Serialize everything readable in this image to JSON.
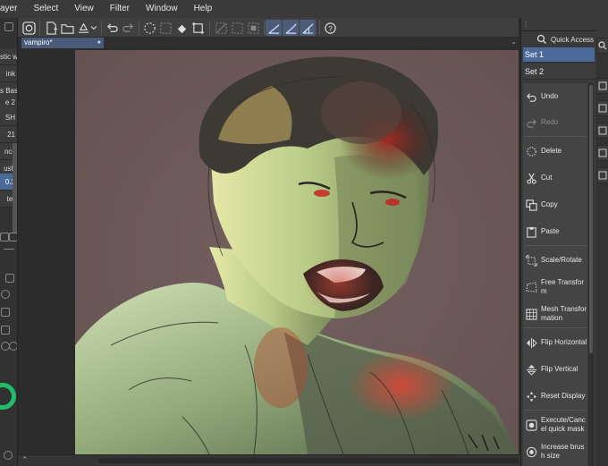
{
  "menubar": {
    "items": [
      "ayer",
      "Select",
      "View",
      "Filter",
      "Window",
      "Help"
    ]
  },
  "toolbar": {
    "icons": [
      "clip-studio-icon",
      "new-file-icon",
      "open-file-icon",
      "save-icon",
      "chevron-down-icon",
      "undo-icon",
      "redo-icon",
      "clear-icon",
      "fill-icon",
      "fill-alt-icon",
      "transform-icon",
      "deselect-icon",
      "invert-icon",
      "show-selection-icon",
      "line-snap-icon",
      "curve-snap-icon",
      "ruler-snap-icon",
      "help-icon"
    ]
  },
  "left_panel": {
    "rows": [
      "stic w",
      "ink",
      "s Basi",
      "e 2",
      "SH",
      "21",
      "ncil",
      "ush",
      "0.3",
      "ter"
    ],
    "selected_index": 8
  },
  "tab": {
    "title": "vampiro*",
    "close": "●"
  },
  "right_panel": {
    "title": "Quick Access",
    "sets": [
      "Set 1",
      "Set 2"
    ],
    "selected_set": 0,
    "commands": [
      {
        "label": "Undo",
        "icon": "undo-icon",
        "enabled": true
      },
      {
        "label": "Redo",
        "icon": "redo-icon",
        "enabled": false
      },
      {
        "label": "Delete",
        "icon": "delete-icon",
        "enabled": true
      },
      {
        "label": "Cut",
        "icon": "scissors-icon",
        "enabled": true
      },
      {
        "label": "Copy",
        "icon": "copy-icon",
        "enabled": true
      },
      {
        "label": "Paste",
        "icon": "paste-icon",
        "enabled": true
      },
      {
        "label": "Scale/Rotate",
        "icon": "scale-rotate-icon",
        "enabled": true
      },
      {
        "label": "Free Transform",
        "icon": "free-transform-icon",
        "enabled": true
      },
      {
        "label": "Mesh Transformation",
        "icon": "mesh-transform-icon",
        "enabled": true
      },
      {
        "label": "Flip Horizontal",
        "icon": "flip-horizontal-icon",
        "enabled": true
      },
      {
        "label": "Flip Vertical",
        "icon": "flip-vertical-icon",
        "enabled": true
      },
      {
        "label": "Reset Display",
        "icon": "reset-display-icon",
        "enabled": true
      },
      {
        "label": "Execute/Cancel quick mask",
        "icon": "quick-mask-icon",
        "enabled": true
      },
      {
        "label": "Increase brush size",
        "icon": "brush-size-icon",
        "enabled": true
      }
    ]
  },
  "colors": {
    "accent": "#4a6b9a",
    "canvas_bg": "#6e5a5c",
    "panel_bg": "#3a3a3a"
  }
}
